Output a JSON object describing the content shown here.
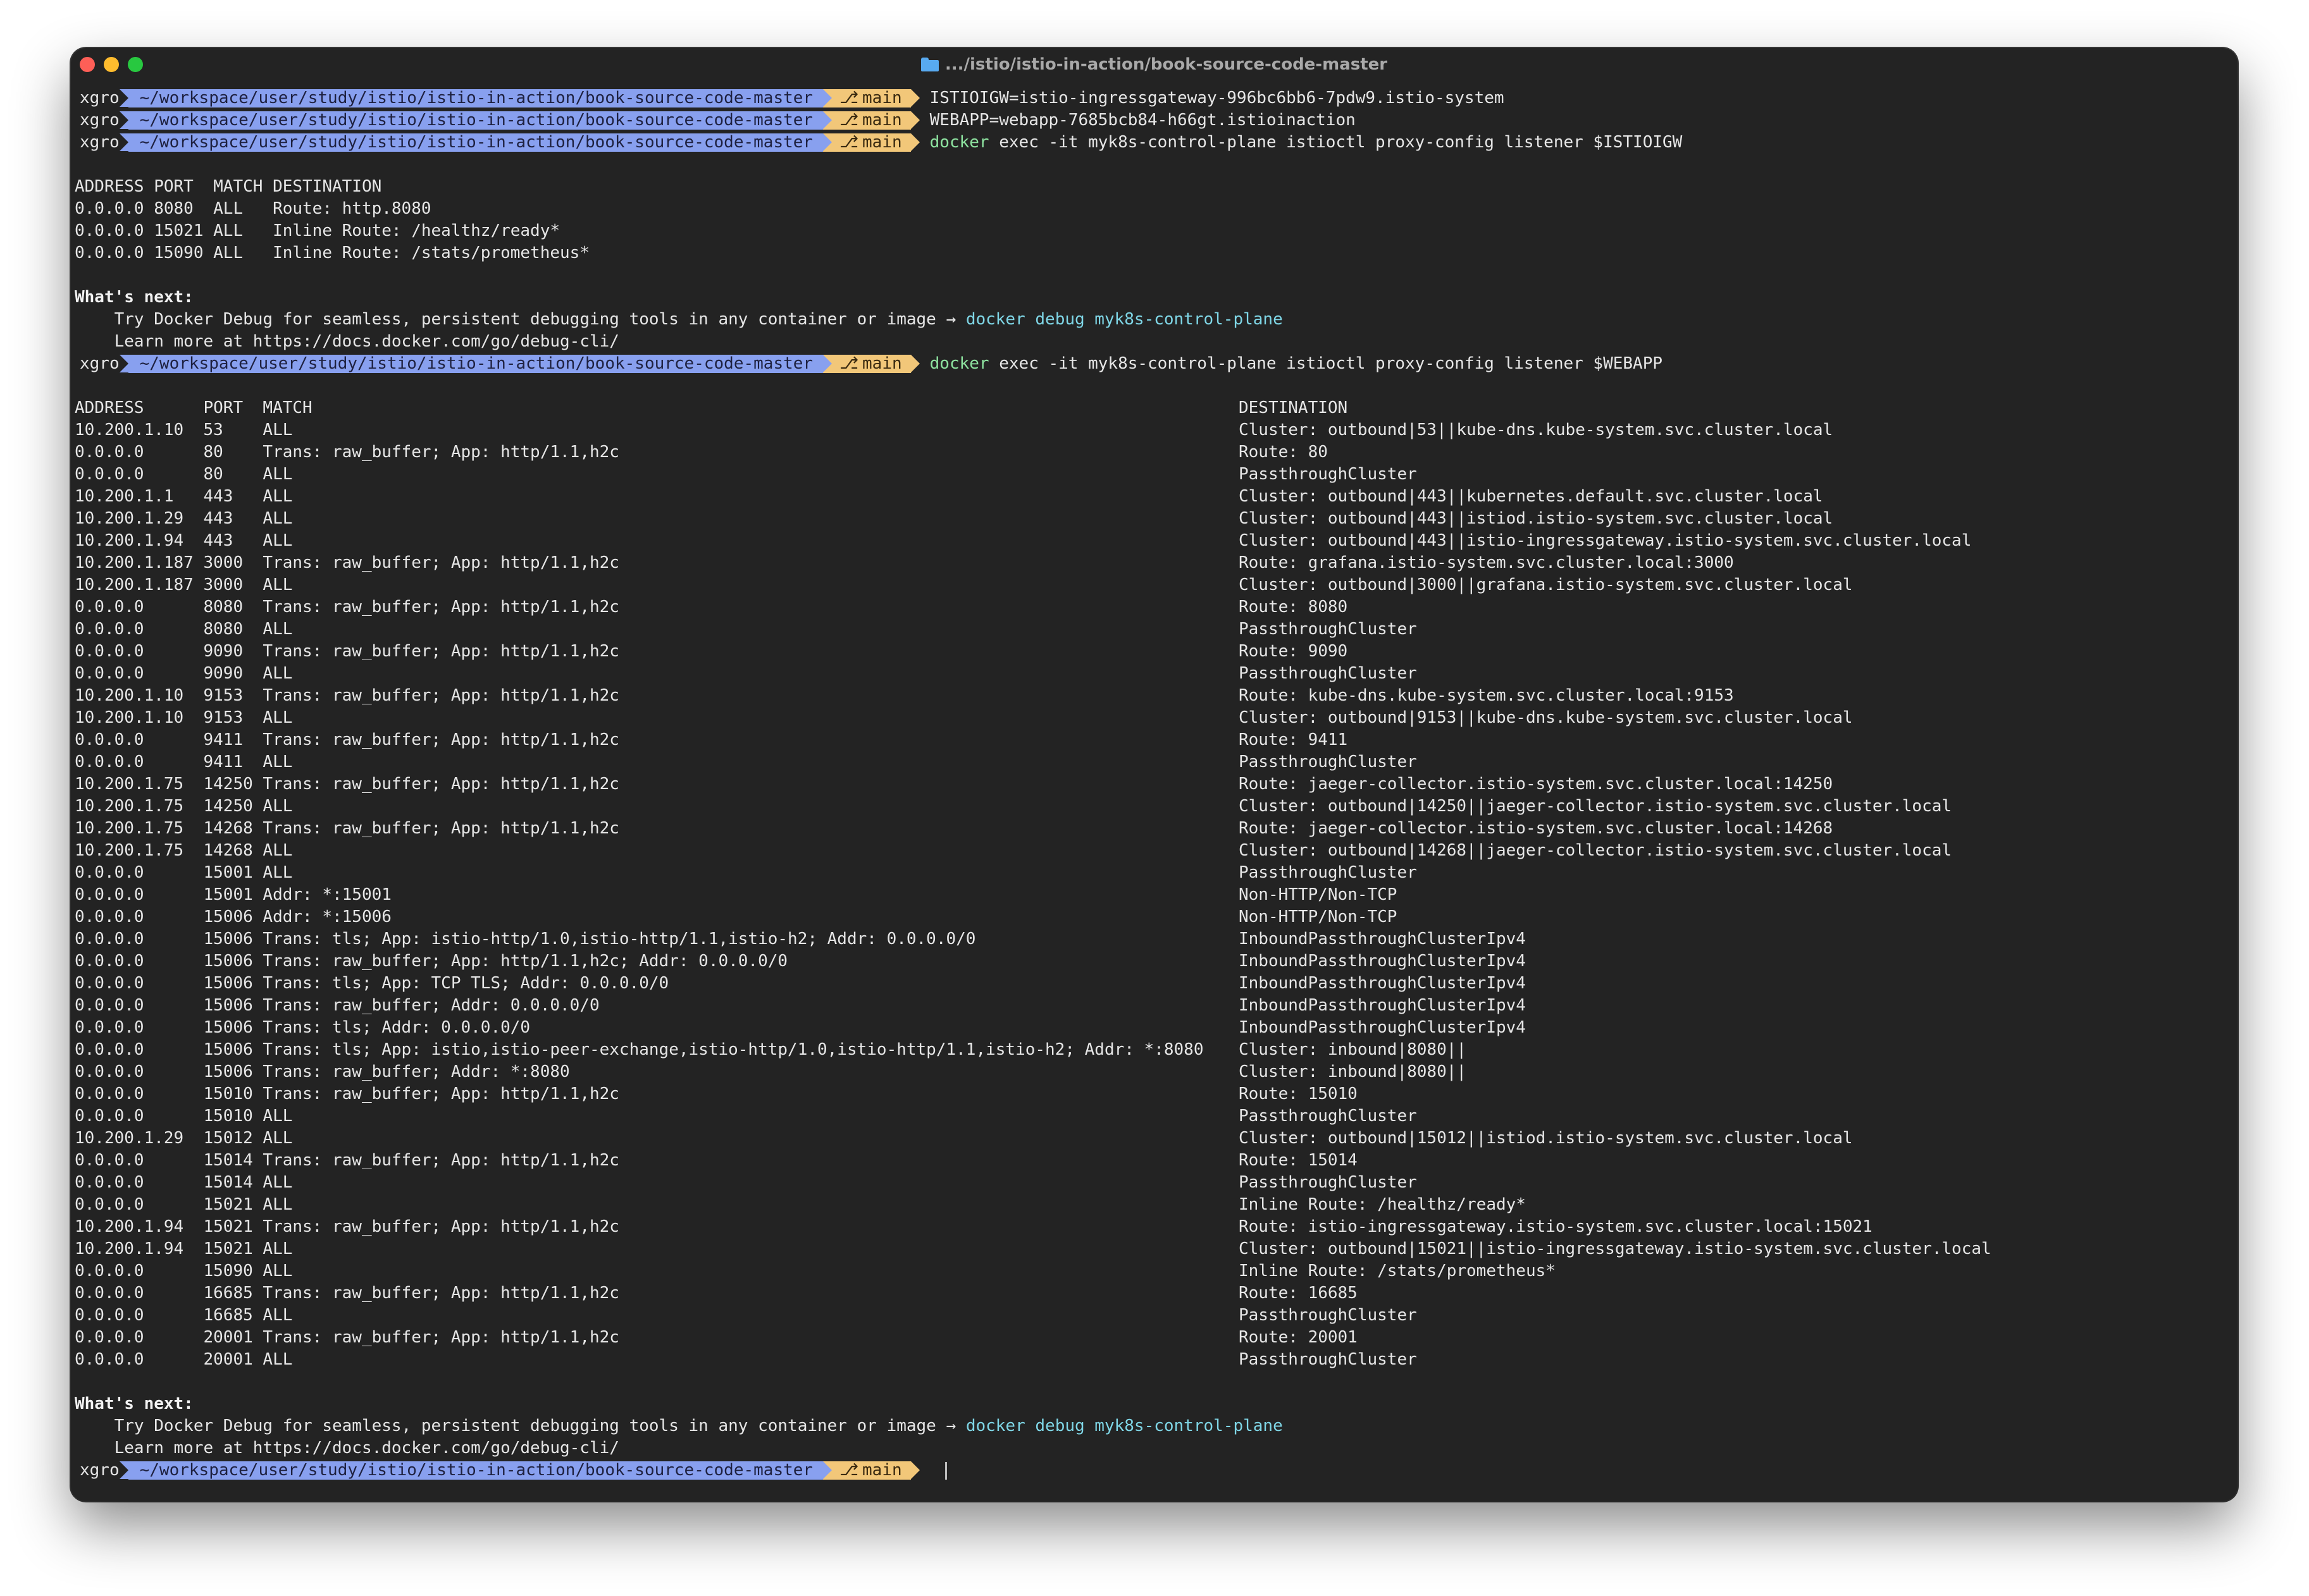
{
  "window": {
    "title": ".../istio/istio-in-action/book-source-code-master"
  },
  "prompt": {
    "user": "xgro",
    "path": "~/workspace/user/study/istio/istio-in-action/book-source-code-master",
    "branch": "main",
    "branch_icon": "git-branch-icon"
  },
  "commands": {
    "c1": "ISTIOIGW=istio-ingressgateway-996bc6bb6-7pdw9.istio-system",
    "c2": "WEBAPP=webapp-7685bcb84-h66gt.istioinaction",
    "c3_bin": "docker",
    "c3_rest": " exec -it myk8s-control-plane istioctl proxy-config listener $ISTIOIGW",
    "c4_bin": "docker",
    "c4_rest": " exec -it myk8s-control-plane istioctl proxy-config listener $WEBAPP"
  },
  "igw_output": [
    "ADDRESS PORT  MATCH DESTINATION",
    "0.0.0.0 8080  ALL   Route: http.8080",
    "0.0.0.0 15021 ALL   Inline Route: /healthz/ready*",
    "0.0.0.0 15090 ALL   Inline Route: /stats/prometheus*"
  ],
  "whats_next": {
    "heading": "What's next:",
    "try_text": "    Try Docker Debug for seamless, persistent debugging tools in any container or image → ",
    "try_cmd": "docker debug myk8s-control-plane",
    "learn": "    Learn more at https://docs.docker.com/go/debug-cli/"
  },
  "webapp_header": {
    "left": "ADDRESS      PORT  MATCH",
    "right": "DESTINATION"
  },
  "webapp_rows": [
    [
      "10.200.1.10  53    ALL",
      "Cluster: outbound|53||kube-dns.kube-system.svc.cluster.local"
    ],
    [
      "0.0.0.0      80    Trans: raw_buffer; App: http/1.1,h2c",
      "Route: 80"
    ],
    [
      "0.0.0.0      80    ALL",
      "PassthroughCluster"
    ],
    [
      "10.200.1.1   443   ALL",
      "Cluster: outbound|443||kubernetes.default.svc.cluster.local"
    ],
    [
      "10.200.1.29  443   ALL",
      "Cluster: outbound|443||istiod.istio-system.svc.cluster.local"
    ],
    [
      "10.200.1.94  443   ALL",
      "Cluster: outbound|443||istio-ingressgateway.istio-system.svc.cluster.local"
    ],
    [
      "10.200.1.187 3000  Trans: raw_buffer; App: http/1.1,h2c",
      "Route: grafana.istio-system.svc.cluster.local:3000"
    ],
    [
      "10.200.1.187 3000  ALL",
      "Cluster: outbound|3000||grafana.istio-system.svc.cluster.local"
    ],
    [
      "0.0.0.0      8080  Trans: raw_buffer; App: http/1.1,h2c",
      "Route: 8080"
    ],
    [
      "0.0.0.0      8080  ALL",
      "PassthroughCluster"
    ],
    [
      "0.0.0.0      9090  Trans: raw_buffer; App: http/1.1,h2c",
      "Route: 9090"
    ],
    [
      "0.0.0.0      9090  ALL",
      "PassthroughCluster"
    ],
    [
      "10.200.1.10  9153  Trans: raw_buffer; App: http/1.1,h2c",
      "Route: kube-dns.kube-system.svc.cluster.local:9153"
    ],
    [
      "10.200.1.10  9153  ALL",
      "Cluster: outbound|9153||kube-dns.kube-system.svc.cluster.local"
    ],
    [
      "0.0.0.0      9411  Trans: raw_buffer; App: http/1.1,h2c",
      "Route: 9411"
    ],
    [
      "0.0.0.0      9411  ALL",
      "PassthroughCluster"
    ],
    [
      "10.200.1.75  14250 Trans: raw_buffer; App: http/1.1,h2c",
      "Route: jaeger-collector.istio-system.svc.cluster.local:14250"
    ],
    [
      "10.200.1.75  14250 ALL",
      "Cluster: outbound|14250||jaeger-collector.istio-system.svc.cluster.local"
    ],
    [
      "10.200.1.75  14268 Trans: raw_buffer; App: http/1.1,h2c",
      "Route: jaeger-collector.istio-system.svc.cluster.local:14268"
    ],
    [
      "10.200.1.75  14268 ALL",
      "Cluster: outbound|14268||jaeger-collector.istio-system.svc.cluster.local"
    ],
    [
      "0.0.0.0      15001 ALL",
      "PassthroughCluster"
    ],
    [
      "0.0.0.0      15001 Addr: *:15001",
      "Non-HTTP/Non-TCP"
    ],
    [
      "0.0.0.0      15006 Addr: *:15006",
      "Non-HTTP/Non-TCP"
    ],
    [
      "0.0.0.0      15006 Trans: tls; App: istio-http/1.0,istio-http/1.1,istio-h2; Addr: 0.0.0.0/0",
      "InboundPassthroughClusterIpv4"
    ],
    [
      "0.0.0.0      15006 Trans: raw_buffer; App: http/1.1,h2c; Addr: 0.0.0.0/0",
      "InboundPassthroughClusterIpv4"
    ],
    [
      "0.0.0.0      15006 Trans: tls; App: TCP TLS; Addr: 0.0.0.0/0",
      "InboundPassthroughClusterIpv4"
    ],
    [
      "0.0.0.0      15006 Trans: raw_buffer; Addr: 0.0.0.0/0",
      "InboundPassthroughClusterIpv4"
    ],
    [
      "0.0.0.0      15006 Trans: tls; Addr: 0.0.0.0/0",
      "InboundPassthroughClusterIpv4"
    ],
    [
      "0.0.0.0      15006 Trans: tls; App: istio,istio-peer-exchange,istio-http/1.0,istio-http/1.1,istio-h2; Addr: *:8080",
      "Cluster: inbound|8080||"
    ],
    [
      "0.0.0.0      15006 Trans: raw_buffer; Addr: *:8080",
      "Cluster: inbound|8080||"
    ],
    [
      "0.0.0.0      15010 Trans: raw_buffer; App: http/1.1,h2c",
      "Route: 15010"
    ],
    [
      "0.0.0.0      15010 ALL",
      "PassthroughCluster"
    ],
    [
      "10.200.1.29  15012 ALL",
      "Cluster: outbound|15012||istiod.istio-system.svc.cluster.local"
    ],
    [
      "0.0.0.0      15014 Trans: raw_buffer; App: http/1.1,h2c",
      "Route: 15014"
    ],
    [
      "0.0.0.0      15014 ALL",
      "PassthroughCluster"
    ],
    [
      "0.0.0.0      15021 ALL",
      "Inline Route: /healthz/ready*"
    ],
    [
      "10.200.1.94  15021 Trans: raw_buffer; App: http/1.1,h2c",
      "Route: istio-ingressgateway.istio-system.svc.cluster.local:15021"
    ],
    [
      "10.200.1.94  15021 ALL",
      "Cluster: outbound|15021||istio-ingressgateway.istio-system.svc.cluster.local"
    ],
    [
      "0.0.0.0      15090 ALL",
      "Inline Route: /stats/prometheus*"
    ],
    [
      "0.0.0.0      16685 Trans: raw_buffer; App: http/1.1,h2c",
      "Route: 16685"
    ],
    [
      "0.0.0.0      16685 ALL",
      "PassthroughCluster"
    ],
    [
      "0.0.0.0      20001 Trans: raw_buffer; App: http/1.1,h2c",
      "Route: 20001"
    ],
    [
      "0.0.0.0      20001 ALL",
      "PassthroughCluster"
    ]
  ]
}
